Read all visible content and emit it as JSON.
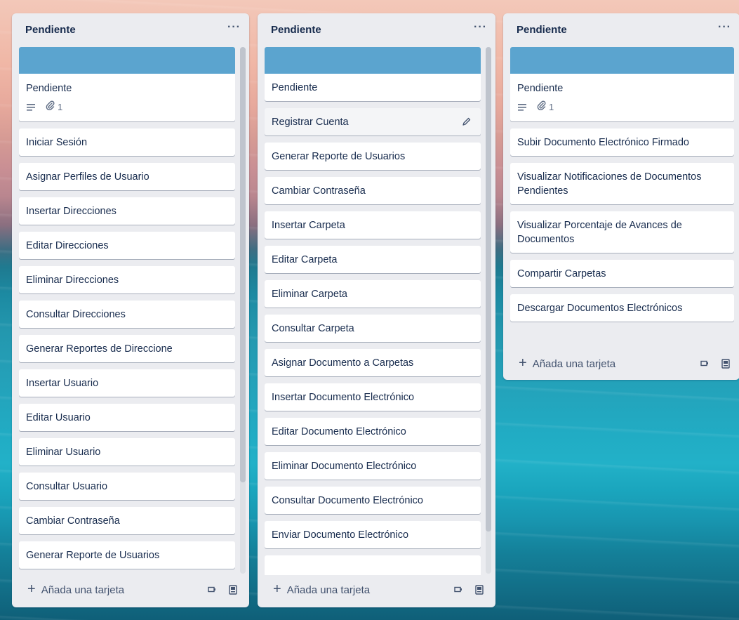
{
  "lists": [
    {
      "title": "Pendiente",
      "menu": "···",
      "cards": [
        {
          "cover": true,
          "title": "Pendiente",
          "badges": {
            "description": true,
            "attachments": "1"
          }
        },
        {
          "title": "Iniciar Sesión"
        },
        {
          "title": "Asignar Perfiles de Usuario"
        },
        {
          "title": "Insertar Direcciones"
        },
        {
          "title": "Editar Direcciones"
        },
        {
          "title": "Eliminar Direcciones"
        },
        {
          "title": "Consultar Direcciones"
        },
        {
          "title": "Generar Reportes de Direccione"
        },
        {
          "title": "Insertar Usuario"
        },
        {
          "title": "Editar Usuario"
        },
        {
          "title": "Eliminar Usuario"
        },
        {
          "title": "Consultar Usuario"
        },
        {
          "title": "Cambiar Contraseña"
        },
        {
          "title": "Generar Reporte de Usuarios"
        }
      ],
      "add_card_label": "Añada una tarjeta"
    },
    {
      "title": "Pendiente",
      "menu": "···",
      "cards": [
        {
          "cover": true,
          "title": "Pendiente"
        },
        {
          "title": "Registrar Cuenta",
          "editing": true
        },
        {
          "title": "Generar Reporte de Usuarios"
        },
        {
          "title": "Cambiar Contraseña"
        },
        {
          "title": "Insertar Carpeta"
        },
        {
          "title": "Editar Carpeta"
        },
        {
          "title": "Eliminar Carpeta"
        },
        {
          "title": "Consultar Carpeta"
        },
        {
          "title": "Asignar Documento a Carpetas"
        },
        {
          "title": "Insertar Documento Electrónico"
        },
        {
          "title": "Editar Documento Electrónico"
        },
        {
          "title": "Eliminar Documento Electrónico"
        },
        {
          "title": "Consultar Documento Electrónico"
        },
        {
          "title": "Enviar Documento Electrónico"
        },
        {
          "title": ""
        }
      ],
      "add_card_label": "Añada una tarjeta"
    },
    {
      "title": "Pendiente",
      "menu": "···",
      "cards": [
        {
          "cover": true,
          "title": "Pendiente",
          "badges": {
            "description": true,
            "attachments": "1"
          }
        },
        {
          "title": "Subir Documento Electrónico Firmado"
        },
        {
          "title": "Visualizar Notificaciones de Documentos Pendientes"
        },
        {
          "title": "Visualizar Porcentaje de Avances de Documentos"
        },
        {
          "title": "Compartir Carpetas"
        },
        {
          "title": "Descargar Documentos Electrónicos"
        }
      ],
      "add_card_label": "Añada una tarjeta"
    }
  ],
  "colors": {
    "cover": "#5ba4cf",
    "list_bg": "#ebecf0",
    "card_bg": "#ffffff",
    "text": "#172b4d",
    "muted": "#5e6c84"
  },
  "icons": {
    "description": "description-icon",
    "attachment": "paperclip-icon",
    "edit": "pencil-icon",
    "plus": "plus-icon",
    "template": "card-template-icon",
    "archive": "archive-icon"
  }
}
